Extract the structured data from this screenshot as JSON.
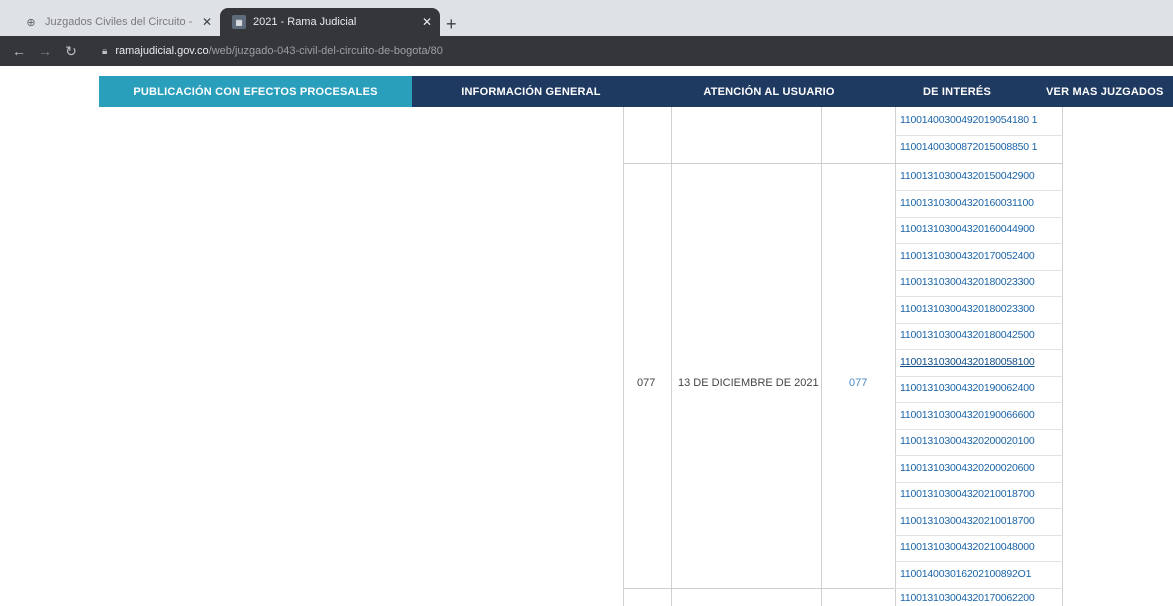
{
  "browser": {
    "tabs": [
      {
        "title": "Juzgados Civiles del Circuito - R",
        "favicon": "globe-icon",
        "active": false
      },
      {
        "title": "2021 - Rama Judicial",
        "favicon": "site-icon",
        "active": true
      }
    ],
    "new_tab": "+",
    "url_host": "ramajudicial.gov.co",
    "url_path": "/web/juzgado-043-civil-del-circuito-de-bogota/80"
  },
  "nav": {
    "items": [
      {
        "label": "PUBLICACIÓN CON EFECTOS PROCESALES",
        "active": true
      },
      {
        "label": "INFORMACIÓN GENERAL",
        "active": false
      },
      {
        "label": "ATENCIÓN AL USUARIO",
        "active": false
      },
      {
        "label": "DE INTERÉS",
        "active": false
      },
      {
        "label": "VER MAS JUZGADOS",
        "active": false
      }
    ],
    "active_color": "#2a9fbc",
    "color": "#1f3a61"
  },
  "table": {
    "top_links": [
      "11001400300492019054180 1",
      "11001400300872015008850 1"
    ],
    "row": {
      "number": "077",
      "date": "13 DE DICIEMBRE DE 2021",
      "link": "077",
      "processes": [
        "110013103004320150042900",
        "110013103004320160031100",
        "110013103004320160044900",
        "110013103004320170052400",
        "110013103004320180023300",
        "110013103004320180023300",
        "110013103004320180042500",
        "110013103004320180058100",
        "110013103004320190062400",
        "110013103004320190066600",
        "110013103004320200020100",
        "110013103004320200020600",
        "110013103004320210018700",
        "110013103004320210018700",
        "110013103004320210048000",
        "110014003016202100892O1"
      ]
    },
    "bottom_link": "110013103004320170062200"
  }
}
